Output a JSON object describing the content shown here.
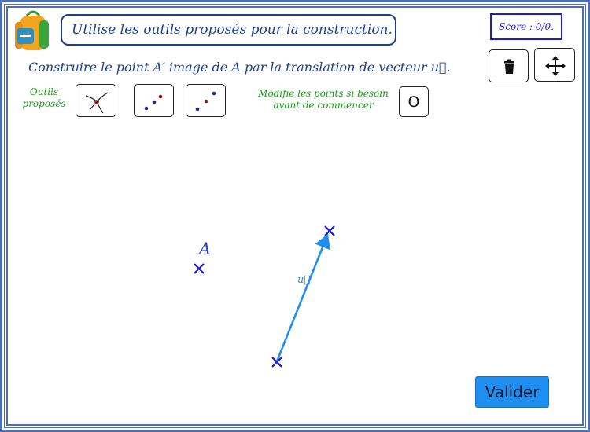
{
  "header": {
    "instruction": "Utilise les outils proposés pour la construction.",
    "score": "Score : 0/0."
  },
  "task": {
    "text": "Construire le point A′ image de A par la translation de vecteur u⃗."
  },
  "tools": {
    "label": "Outils proposés",
    "label_line1": "Outils",
    "label_line2": "proposés",
    "items": [
      {
        "name": "compass-tool",
        "icon": "compass-arcs-icon"
      },
      {
        "name": "point-tool",
        "icon": "points-icon"
      },
      {
        "name": "point-tool-2",
        "icon": "points-icon"
      }
    ]
  },
  "modify": {
    "line1": "Modifie les points si besoin",
    "line2": "avant de commencer",
    "button_label": "O"
  },
  "actions": {
    "delete_icon": "trash-icon",
    "move_icon": "move-arrows-icon"
  },
  "canvas": {
    "point_a_label": "A",
    "vector_label": "u⃗"
  },
  "footer": {
    "submit_label": "Valider"
  },
  "colors": {
    "frame": "#4a6fb4",
    "text_blue": "#1f3f8f",
    "green": "#1a9a1a",
    "point_blue": "#1b1bd6",
    "vector": "#1e8ff0"
  }
}
